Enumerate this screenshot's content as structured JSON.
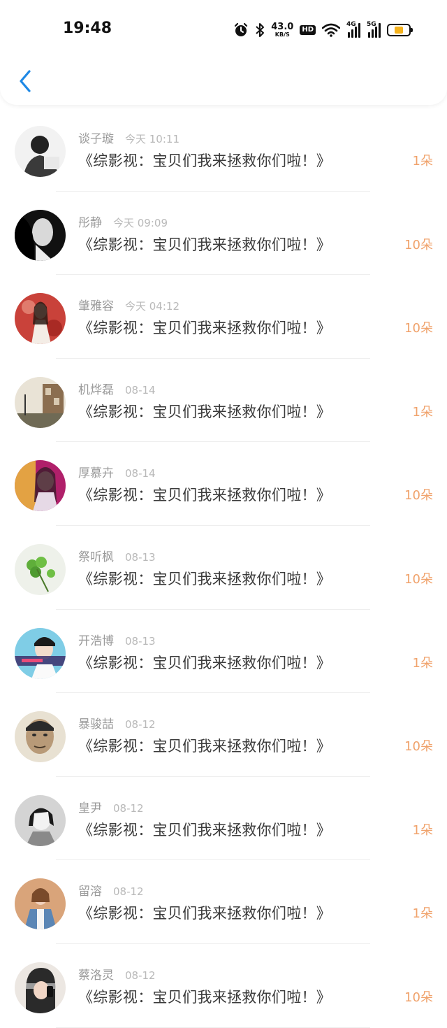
{
  "status_bar": {
    "time": "19:48",
    "speed_value": "43.0",
    "speed_unit": "KB/S",
    "hd_label": "HD",
    "net1_label": "4G",
    "net2_label": "5G",
    "battery_level": 0.45,
    "battery_color": "#f5b21c"
  },
  "header": {
    "back_icon": "chevron-left-icon",
    "accent_color": "#1e88e5"
  },
  "items": [
    {
      "name": "谈子璇",
      "date": "今天 10:11",
      "title": "《综影视：宝贝们我来拯救你们啦！》",
      "count": "1朵"
    },
    {
      "name": "彤静",
      "date": "今天 09:09",
      "title": "《综影视：宝贝们我来拯救你们啦！》",
      "count": "10朵"
    },
    {
      "name": "肇雅容",
      "date": "今天 04:12",
      "title": "《综影视：宝贝们我来拯救你们啦！》",
      "count": "10朵"
    },
    {
      "name": "机烨磊",
      "date": "08-14",
      "title": "《综影视：宝贝们我来拯救你们啦！》",
      "count": "1朵"
    },
    {
      "name": "厚慕卉",
      "date": "08-14",
      "title": "《综影视：宝贝们我来拯救你们啦！》",
      "count": "10朵"
    },
    {
      "name": "祭听枫",
      "date": "08-13",
      "title": "《综影视：宝贝们我来拯救你们啦！》",
      "count": "10朵"
    },
    {
      "name": "开浩博",
      "date": "08-13",
      "title": "《综影视：宝贝们我来拯救你们啦！》",
      "count": "1朵"
    },
    {
      "name": "暴骏喆",
      "date": "08-12",
      "title": "《综影视：宝贝们我来拯救你们啦！》",
      "count": "10朵"
    },
    {
      "name": "皇尹",
      "date": "08-12",
      "title": "《综影视：宝贝们我来拯救你们啦！》",
      "count": "1朵"
    },
    {
      "name": "留溶",
      "date": "08-12",
      "title": "《综影视：宝贝们我来拯救你们啦！》",
      "count": "1朵"
    },
    {
      "name": "蔡洛灵",
      "date": "08-12",
      "title": "《综影视：宝贝们我来拯救你们啦！》",
      "count": "10朵"
    }
  ]
}
